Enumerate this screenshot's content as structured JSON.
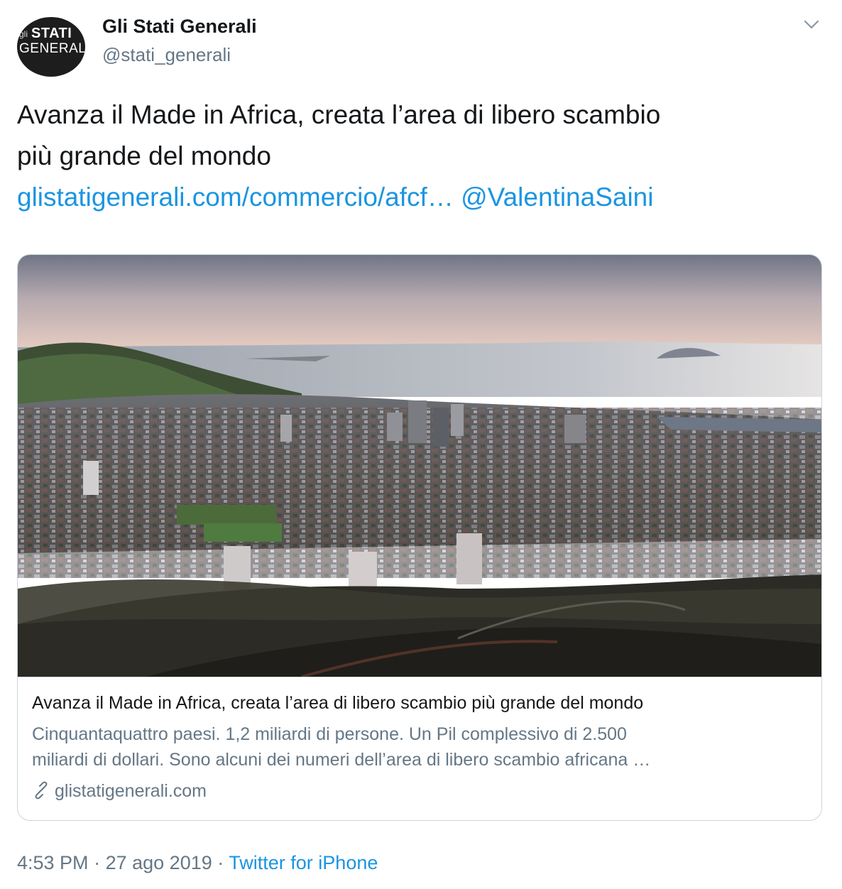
{
  "account": {
    "name": "Gli Stati Generali",
    "handle": "@stati_generali",
    "avatar": {
      "small": "gli",
      "line1": "STATI",
      "line2": "GENERALI"
    }
  },
  "menu_icon": "chevron-down-icon",
  "tweet": {
    "text_line1": "Avanza il Made in Africa, creata l’area di libero scambio",
    "text_line2": "più grande del mondo",
    "link": "glistatigenerali.com/commercio/afcf…",
    "mention": "@ValentinaSaini"
  },
  "card": {
    "image_alt": "Aerial view of a coastal city at dusk",
    "title": "Avanza il Made in Africa, creata l’area di libero scambio più grande del mondo",
    "description_line1": "Cinquantaquattro paesi. 1,2 miliardi di persone. Un Pil complessivo di 2.500",
    "description_line2": "miliardi di dollari. Sono alcuni dei numeri dell’area di libero scambio africana …",
    "domain": "glistatigenerali.com",
    "domain_icon": "link-icon"
  },
  "meta": {
    "time": "4:53 PM",
    "separator": "·",
    "date": "27 ago 2019",
    "source": "Twitter for iPhone"
  },
  "colors": {
    "link": "#1b95e0",
    "secondary": "#657786",
    "border": "#ccd6dd"
  }
}
